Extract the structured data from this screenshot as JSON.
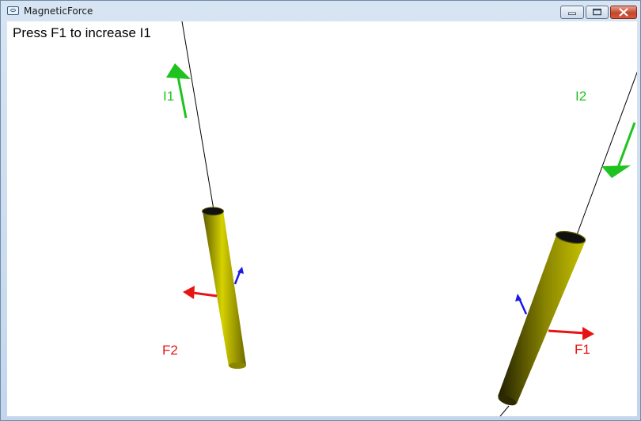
{
  "window": {
    "title": "MagneticForce",
    "icon": "app-window-icon",
    "controls": [
      "minimize-icon",
      "maximize-icon",
      "close-icon"
    ]
  },
  "scene": {
    "hint": "Press F1 to increase I1",
    "labels": {
      "current_1": "I1",
      "current_2": "I2",
      "force_1": "F1",
      "force_2": "F2"
    },
    "colors": {
      "current_arrow": "#1fc21f",
      "force_arrow": "#e81414",
      "field_arrow": "#1a1ae6",
      "wire": "#c9c400",
      "thread": "#000000",
      "background": "#ffffff"
    }
  }
}
